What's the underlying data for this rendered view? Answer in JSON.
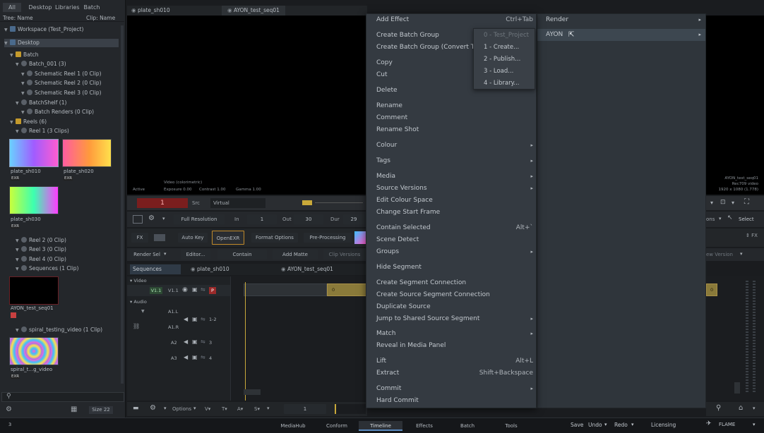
{
  "left_panel": {
    "tabs": [
      "All",
      "Desktop",
      "Libraries",
      "Batch"
    ],
    "tree_header": {
      "left": "Tree: Name",
      "right": "Clip: Name"
    },
    "tree": [
      {
        "label": "Workspace (Test_Project)"
      },
      {
        "label": "Desktop"
      },
      {
        "label": "Batch"
      },
      {
        "label": "Batch_001 (3)"
      },
      {
        "label": "Schematic Reel 1 (0 Clip)"
      },
      {
        "label": "Schematic Reel 2 (0 Clip)"
      },
      {
        "label": "Schematic Reel 3 (0 Clip)"
      },
      {
        "label": "BatchShelf (1)"
      },
      {
        "label": "Batch Renders (0 Clip)"
      },
      {
        "label": "Reels (6)"
      },
      {
        "label": "Reel 1 (3 Clips)"
      }
    ],
    "clips": [
      {
        "name": "plate_sh010",
        "badge": "EXR"
      },
      {
        "name": "plate_sh020",
        "badge": "EXR"
      },
      {
        "name": "plate_sh030",
        "badge": "EXR"
      }
    ],
    "tree2": [
      {
        "label": "Reel 2 (0 Clip)"
      },
      {
        "label": "Reel 3 (0 Clip)"
      },
      {
        "label": "Reel 4 (0 Clip)"
      },
      {
        "label": "Sequences (1 Clip)"
      }
    ],
    "seq_clip": {
      "name": "AYON_test_seq01"
    },
    "tree3": [
      {
        "label": "spiral_testing_video (1 Clip)"
      }
    ],
    "video_clip": {
      "name": "spiral_t...g_video",
      "badge": "EXR"
    },
    "footer": {
      "size_label": "Size 22"
    }
  },
  "viewer": {
    "tabs": [
      "plate_sh010",
      "AYON_test_seq01"
    ],
    "overlay": {
      "video_label": "Video (colorimetric)",
      "active": "Active",
      "exposure": "Exposure 0.00",
      "contrast": "Contrast 1.00",
      "gamma": "Gamma 1.00"
    },
    "right_info": [
      "AYON_test_seq01",
      "Rec709 video",
      "1920 x 1080 (1.778)"
    ]
  },
  "transport": {
    "frame": "1",
    "src": "Src",
    "virtual": "Virtual",
    "resolution": "Full Resolution",
    "in_label": "In",
    "in_value": "1",
    "out_label": "Out",
    "out_value": "30",
    "dur_label": "Dur",
    "dur_value": "29",
    "select": "Select",
    "ions": "ons"
  },
  "tools": {
    "fx": "FX",
    "auto_key": "Auto Key",
    "openexr": "OpenEXR",
    "format_options": "Format Options",
    "pre_processing": "Pre-Processing",
    "render_sel": "Render Sel",
    "editor": "Editor...",
    "contain": "Contain",
    "add_matte": "Add Matte",
    "clip_versions": "Clip Versions",
    "fx_right": "FX",
    "version_right": "ew Version"
  },
  "timeline": {
    "tabs": [
      "Sequences",
      "plate_sh010",
      "AYON_test_seq01"
    ],
    "video_section": "Video",
    "v1": "V1.1",
    "v1b": "V1.1",
    "audio_section": "Audio",
    "a1": "A1.L",
    "a1r": "A1.R",
    "a1_ch": "1-2",
    "a2": "A2",
    "a2_ch": "3",
    "a3": "A3",
    "a3_ch": "4",
    "seg_label": "0",
    "seg_right_label": "0",
    "options": "Options",
    "frame_field": "1"
  },
  "context_menu": {
    "items": [
      {
        "label": "Add Effect",
        "shortcut": "Ctrl+Tab"
      },
      {
        "label": "Create Batch Group"
      },
      {
        "label": "Create Batch Group (Convert TL"
      },
      {
        "label": "Copy"
      },
      {
        "label": "Cut"
      },
      {
        "label": "Delete"
      },
      {
        "label": "Rename"
      },
      {
        "label": "Comment"
      },
      {
        "label": "Rename Shot"
      },
      {
        "label": "Colour",
        "arrow": "▸"
      },
      {
        "label": "Tags",
        "arrow": "▸"
      },
      {
        "label": "Media",
        "arrow": "▸"
      },
      {
        "label": "Source Versions",
        "arrow": "▸"
      },
      {
        "label": "Edit Colour Space"
      },
      {
        "label": "Change Start Frame"
      },
      {
        "label": "Contain Selected",
        "shortcut": "Alt+`"
      },
      {
        "label": "Scene Detect"
      },
      {
        "label": "Groups",
        "arrow": "▸"
      },
      {
        "label": "Hide Segment"
      },
      {
        "label": "Create Segment Connection"
      },
      {
        "label": "Create Source Segment Connection"
      },
      {
        "label": "Duplicate Source"
      },
      {
        "label": "Jump to Shared Source Segment",
        "arrow": "▸"
      },
      {
        "label": "Match",
        "arrow": "▸"
      },
      {
        "label": "Reveal in Media Panel"
      },
      {
        "label": "Lift",
        "shortcut": "Alt+L"
      },
      {
        "label": "Extract",
        "shortcut": "Shift+Backspace"
      },
      {
        "label": "Commit",
        "arrow": "▸"
      },
      {
        "label": "Hard Commit"
      }
    ]
  },
  "submenu": {
    "items": [
      {
        "label": "Render",
        "arrow": "▸"
      },
      {
        "label": "AYON",
        "arrow": "▸"
      }
    ]
  },
  "ayon_menu": {
    "items": [
      {
        "label": "0 - Test_Project",
        "disabled": true
      },
      {
        "label": "1 - Create..."
      },
      {
        "label": "2 - Publish..."
      },
      {
        "label": "3 - Load..."
      },
      {
        "label": "4 - Library..."
      }
    ]
  },
  "bottom_bar": {
    "tabs": [
      "MediaHub",
      "Conform",
      "Timeline",
      "Effects",
      "Batch",
      "Tools"
    ],
    "active_tab": "Timeline",
    "save": "Save",
    "undo": "Undo",
    "redo": "Redo",
    "licensing": "Licensing",
    "brand": "FLAME",
    "left_mark": "3"
  },
  "colors": {
    "accent_yellow": "#c9a93a",
    "frame_red": "#7a1e1e",
    "openexr_border": "#c08a2a",
    "timeline_segment": "#8a7a3a"
  }
}
